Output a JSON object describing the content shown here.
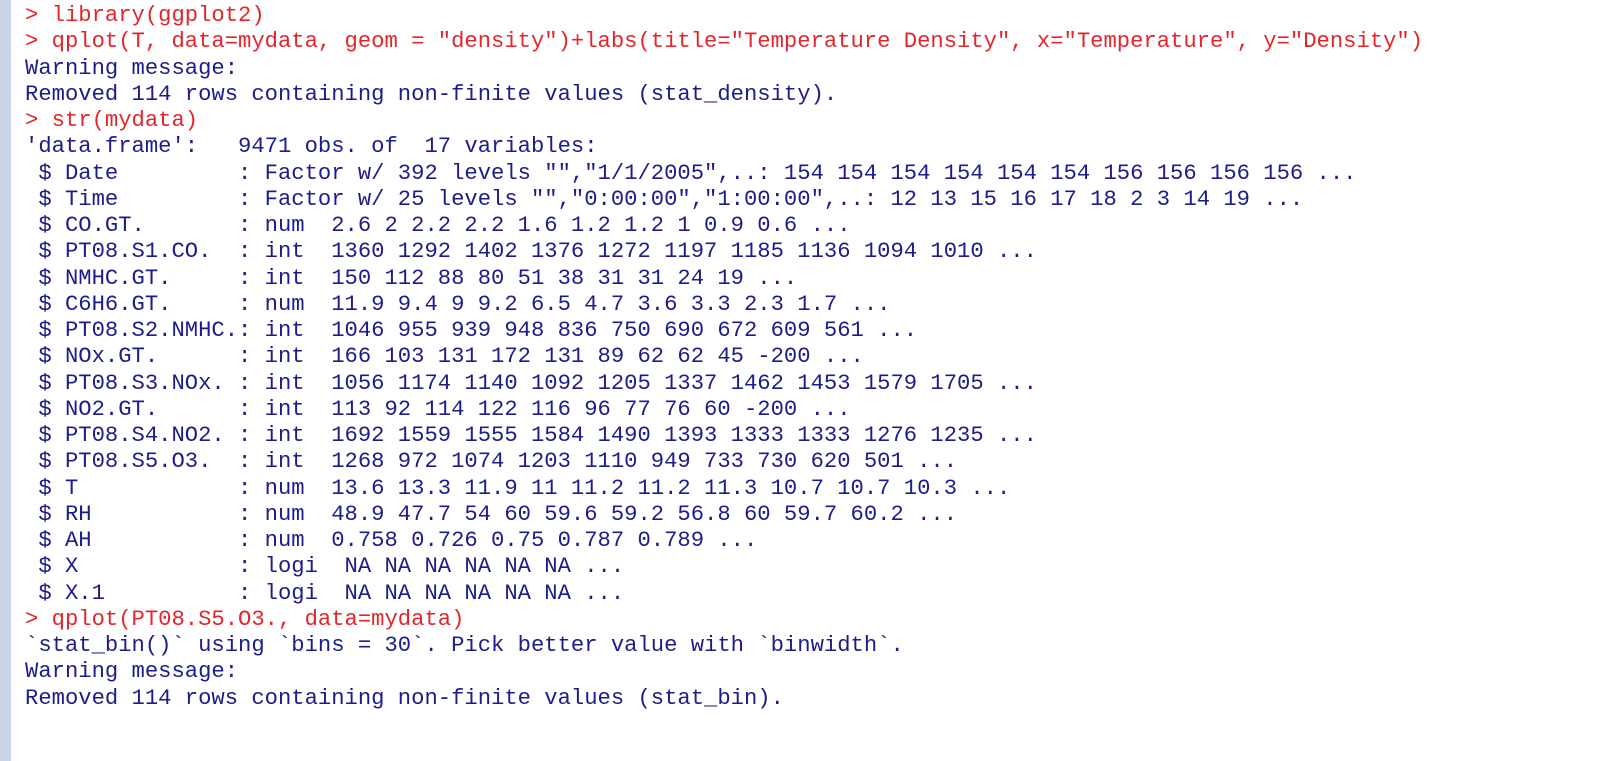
{
  "console": {
    "lines": [
      {
        "type": "input",
        "text": "> library(ggplot2)"
      },
      {
        "type": "input",
        "text": "> qplot(T, data=mydata, geom = \"density\")+labs(title=\"Temperature Density\", x=\"Temperature\", y=\"Density\")"
      },
      {
        "type": "output",
        "text": "Warning message:"
      },
      {
        "type": "output",
        "text": "Removed 114 rows containing non-finite values (stat_density)."
      },
      {
        "type": "input",
        "text": "> str(mydata)"
      },
      {
        "type": "output",
        "text": "'data.frame':   9471 obs. of  17 variables:"
      },
      {
        "type": "output",
        "text": " $ Date         : Factor w/ 392 levels \"\",\"1/1/2005\",..: 154 154 154 154 154 154 156 156 156 156 ..."
      },
      {
        "type": "output",
        "text": " $ Time         : Factor w/ 25 levels \"\",\"0:00:00\",\"1:00:00\",..: 12 13 15 16 17 18 2 3 14 19 ..."
      },
      {
        "type": "output",
        "text": " $ CO.GT.       : num  2.6 2 2.2 2.2 1.6 1.2 1.2 1 0.9 0.6 ..."
      },
      {
        "type": "output",
        "text": " $ PT08.S1.CO.  : int  1360 1292 1402 1376 1272 1197 1185 1136 1094 1010 ..."
      },
      {
        "type": "output",
        "text": " $ NMHC.GT.     : int  150 112 88 80 51 38 31 31 24 19 ..."
      },
      {
        "type": "output",
        "text": " $ C6H6.GT.     : num  11.9 9.4 9 9.2 6.5 4.7 3.6 3.3 2.3 1.7 ..."
      },
      {
        "type": "output",
        "text": " $ PT08.S2.NMHC.: int  1046 955 939 948 836 750 690 672 609 561 ..."
      },
      {
        "type": "output",
        "text": " $ NOx.GT.      : int  166 103 131 172 131 89 62 62 45 -200 ..."
      },
      {
        "type": "output",
        "text": " $ PT08.S3.NOx. : int  1056 1174 1140 1092 1205 1337 1462 1453 1579 1705 ..."
      },
      {
        "type": "output",
        "text": " $ NO2.GT.      : int  113 92 114 122 116 96 77 76 60 -200 ..."
      },
      {
        "type": "output",
        "text": " $ PT08.S4.NO2. : int  1692 1559 1555 1584 1490 1393 1333 1333 1276 1235 ..."
      },
      {
        "type": "output",
        "text": " $ PT08.S5.O3.  : int  1268 972 1074 1203 1110 949 733 730 620 501 ..."
      },
      {
        "type": "output",
        "text": " $ T            : num  13.6 13.3 11.9 11 11.2 11.2 11.3 10.7 10.7 10.3 ..."
      },
      {
        "type": "output",
        "text": " $ RH           : num  48.9 47.7 54 60 59.6 59.2 56.8 60 59.7 60.2 ..."
      },
      {
        "type": "output",
        "text": " $ AH           : num  0.758 0.726 0.75 0.787 0.789 ..."
      },
      {
        "type": "output",
        "text": " $ X            : logi  NA NA NA NA NA NA ..."
      },
      {
        "type": "output",
        "text": " $ X.1          : logi  NA NA NA NA NA NA ..."
      },
      {
        "type": "input",
        "text": "> qplot(PT08.S5.O3., data=mydata)"
      },
      {
        "type": "output",
        "text": "`stat_bin()` using `bins = 30`. Pick better value with `binwidth`."
      },
      {
        "type": "output",
        "text": "Warning message:"
      },
      {
        "type": "output",
        "text": "Removed 114 rows containing non-finite values (stat_bin)."
      }
    ]
  }
}
